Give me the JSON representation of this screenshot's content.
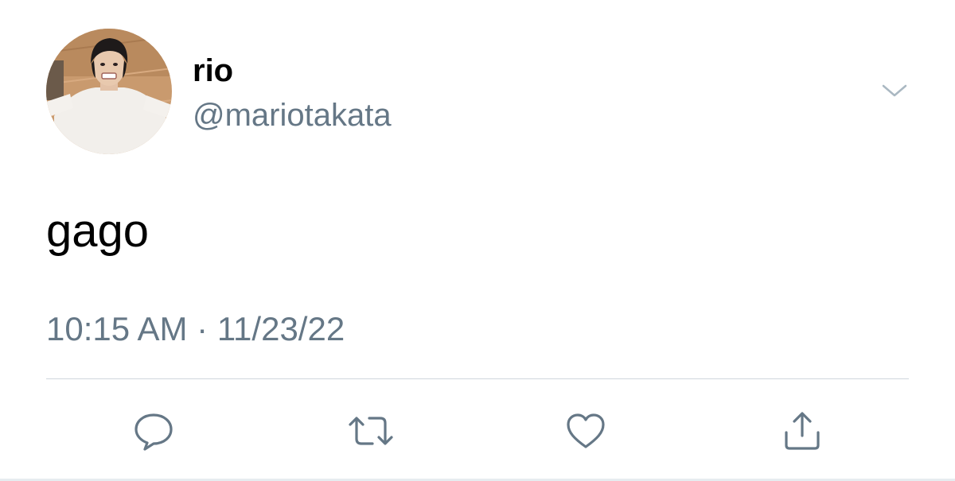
{
  "tweet": {
    "author": {
      "display_name": "rio",
      "handle": "@mariotakata",
      "avatar_icon": "profile-photo"
    },
    "menu_icon": "chevron-down-icon",
    "text": "gago",
    "time": "10:15 AM",
    "separator": "·",
    "date": "11/23/22",
    "actions": [
      {
        "name": "reply",
        "icon": "speech-bubble-icon"
      },
      {
        "name": "retweet",
        "icon": "retweet-arrows-icon"
      },
      {
        "name": "like",
        "icon": "heart-icon"
      },
      {
        "name": "share",
        "icon": "share-upload-icon"
      }
    ]
  },
  "colors": {
    "text_primary": "#000000",
    "text_secondary": "#657786",
    "divider": "#cfd6dc",
    "background": "#ffffff"
  }
}
